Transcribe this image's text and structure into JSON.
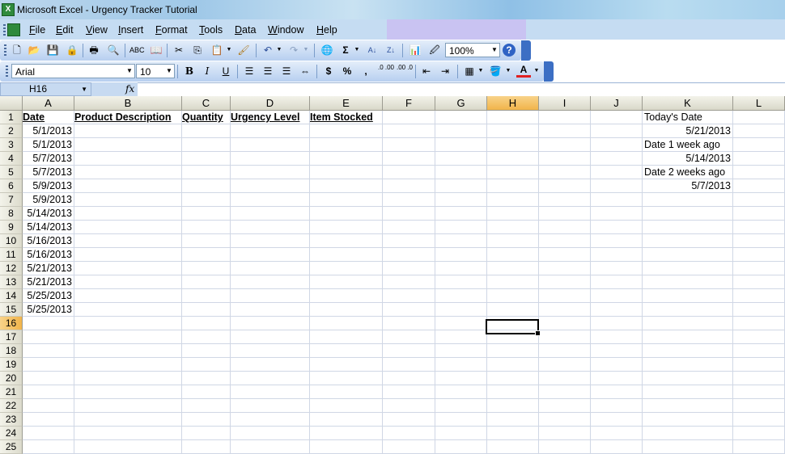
{
  "window": {
    "title": "Microsoft Excel - Urgency Tracker Tutorial",
    "app_icon": "X"
  },
  "menu": [
    {
      "key": "F",
      "rest": "ile"
    },
    {
      "key": "E",
      "rest": "dit"
    },
    {
      "key": "V",
      "rest": "iew"
    },
    {
      "key": "I",
      "rest": "nsert"
    },
    {
      "key": "F",
      "rest": "ormat",
      "pre": ""
    },
    {
      "key": "T",
      "rest": "ools"
    },
    {
      "key": "D",
      "rest": "ata"
    },
    {
      "key": "W",
      "rest": "indow"
    },
    {
      "key": "H",
      "rest": "elp"
    }
  ],
  "toolbar": {
    "zoom": "100%",
    "font": "Arial",
    "size": "10",
    "bold": "B",
    "italic": "I",
    "underline": "U",
    "sigma": "Σ",
    "currency": "$",
    "percent": "%",
    "comma": ",",
    "inc_dec": ".0 .00",
    "dec_dec": ".00 .0",
    "help": "?"
  },
  "formula_bar": {
    "name_box": "H16",
    "fx": "fx",
    "value": ""
  },
  "columns": [
    "A",
    "B",
    "C",
    "D",
    "E",
    "F",
    "G",
    "H",
    "I",
    "J",
    "K",
    "L"
  ],
  "rows": [
    "1",
    "2",
    "3",
    "4",
    "5",
    "6",
    "7",
    "8",
    "9",
    "10",
    "11",
    "12",
    "13",
    "14",
    "15",
    "16",
    "17",
    "18",
    "19",
    "20",
    "21",
    "22",
    "23",
    "24",
    "25"
  ],
  "selected": {
    "column": "H",
    "row": "16"
  },
  "headers": {
    "A": "Date",
    "B": "Product Description",
    "C": "Quantity",
    "D": "Urgency Level",
    "E": "Item Stocked"
  },
  "dates": [
    "5/1/2013",
    "5/1/2013",
    "5/7/2013",
    "5/7/2013",
    "5/9/2013",
    "5/9/2013",
    "5/14/2013",
    "5/14/2013",
    "5/16/2013",
    "5/16/2013",
    "5/21/2013",
    "5/21/2013",
    "5/25/2013",
    "5/25/2013"
  ],
  "side": {
    "today_label": "Today's Date",
    "today": "5/21/2013",
    "week1_label": "Date 1 week ago",
    "week1": "5/14/2013",
    "week2_label": "Date 2 weeks ago",
    "week2": "5/7/2013"
  }
}
